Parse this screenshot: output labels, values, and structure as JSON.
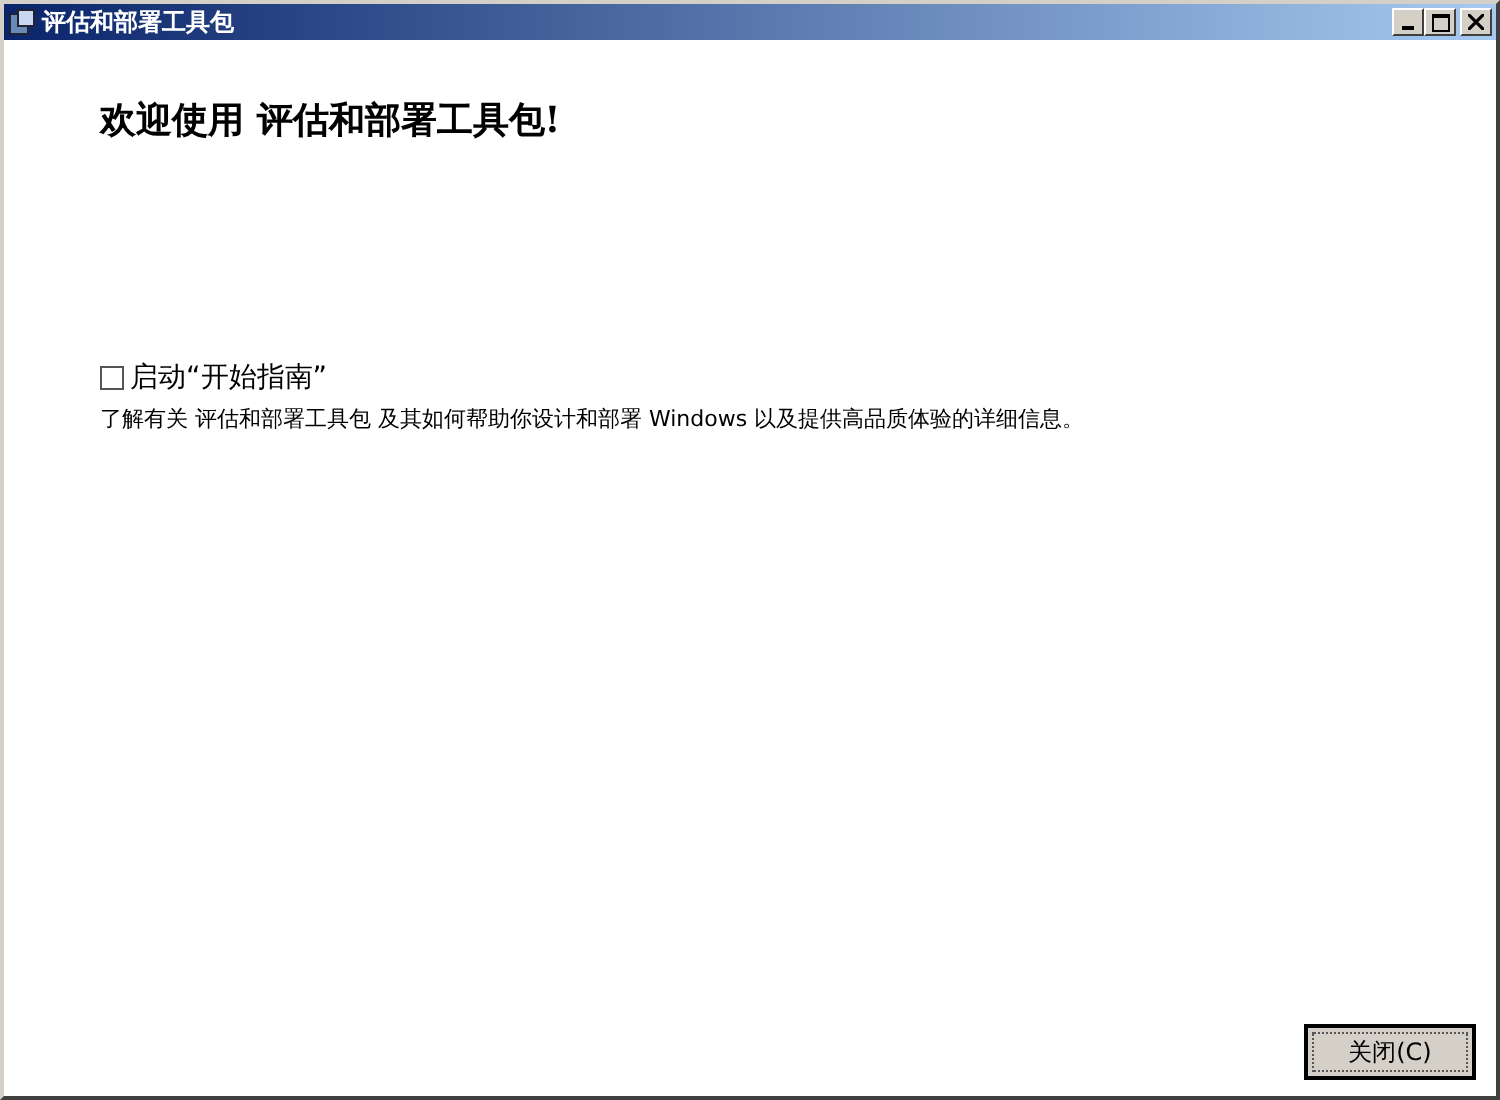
{
  "window": {
    "title": "评估和部署工具包"
  },
  "heading": "欢迎使用 评估和部署工具包!",
  "option": {
    "label": "启动“开始指南”",
    "checked": false
  },
  "description": "了解有关 评估和部署工具包 及其如何帮助你设计和部署 Windows 以及提供高品质体验的详细信息。",
  "buttons": [
    {
      "label": "关闭(C)",
      "selected": true
    }
  ]
}
